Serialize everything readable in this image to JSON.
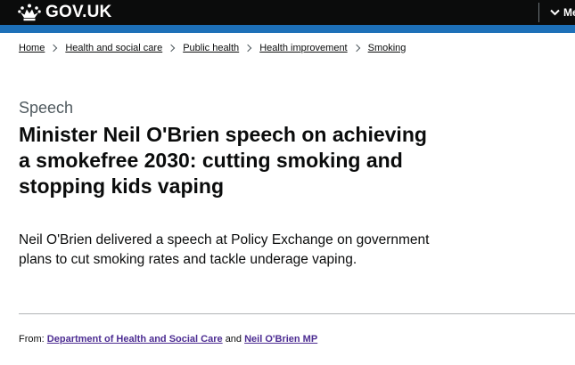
{
  "header": {
    "logo_text": "GOV.UK",
    "menu_label": "Menu"
  },
  "breadcrumbs": [
    {
      "label": "Home"
    },
    {
      "label": "Health and social care"
    },
    {
      "label": "Public health"
    },
    {
      "label": "Health improvement"
    },
    {
      "label": "Smoking"
    }
  ],
  "page": {
    "caption": "Speech",
    "title": "Minister Neil O'Brien speech on achieving a smokefree 2030: cutting smoking and stopping kids vaping",
    "lead": "Neil O'Brien delivered a speech at Policy Exchange on government plans to cut smoking rates and tackle underage vaping."
  },
  "metadata": {
    "from_label": "From:",
    "organisations": [
      "Department of Health and Social Care",
      "Neil O'Brien MP"
    ],
    "conjunction": "and"
  },
  "colors": {
    "header_bg": "#0b0c0c",
    "brand_blue": "#1d70b8",
    "link_visited": "#4c2c92",
    "secondary_text": "#505a5f"
  }
}
